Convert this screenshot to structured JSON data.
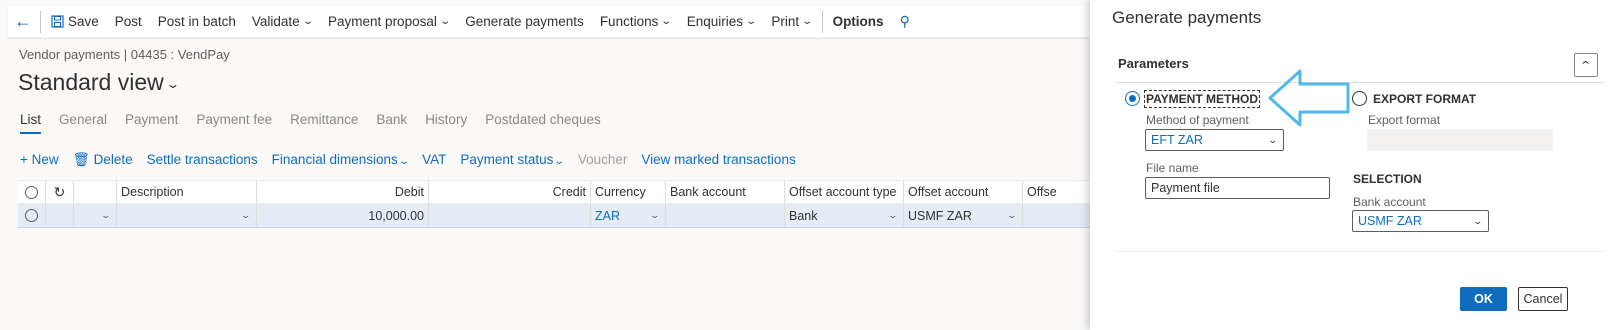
{
  "toolbar": {
    "save": "Save",
    "post": "Post",
    "post_in_batch": "Post in batch",
    "validate": "Validate",
    "payment_proposal": "Payment proposal",
    "generate_payments": "Generate payments",
    "functions": "Functions",
    "enquiries": "Enquiries",
    "print": "Print",
    "options": "Options",
    "back_icon": "arrow-left-icon",
    "search_icon": "search-icon"
  },
  "breadcrumb": "Vendor payments  |  04435 : VendPay",
  "view_title": "Standard view",
  "tabs": [
    "List",
    "General",
    "Payment",
    "Payment fee",
    "Remittance",
    "Bank",
    "History",
    "Postdated cheques"
  ],
  "actions": {
    "new": "New",
    "delete": "Delete",
    "settle": "Settle transactions",
    "financial_dimensions": "Financial dimensions",
    "vat": "VAT",
    "payment_status": "Payment status",
    "voucher": "Voucher",
    "view_marked": "View marked transactions"
  },
  "grid": {
    "headers": [
      "Description",
      "Debit",
      "Credit",
      "Currency",
      "Bank account",
      "Offset account type",
      "Offset account",
      "Offse"
    ],
    "row": {
      "description": "",
      "debit": "10,000.00",
      "credit": "",
      "currency": "ZAR",
      "bank_account": "",
      "offset_account_type": "Bank",
      "offset_account": "USMF ZAR"
    }
  },
  "dialog": {
    "title": "Generate payments",
    "parameters": "Parameters",
    "payment_method_label": "PAYMENT METHOD",
    "export_format_label": "EXPORT FORMAT",
    "method_of_payment_label": "Method of payment",
    "method_of_payment_value": "EFT ZAR",
    "export_format_field_label": "Export format",
    "file_name_label": "File name",
    "file_name_value": "Payment file",
    "selection_heading": "SELECTION",
    "bank_account_label": "Bank account",
    "bank_account_value": "USMF ZAR",
    "ok": "OK",
    "cancel": "Cancel"
  },
  "colors": {
    "accent": "#0f6cbd",
    "annotation_arrow": "#4fb8e8"
  }
}
